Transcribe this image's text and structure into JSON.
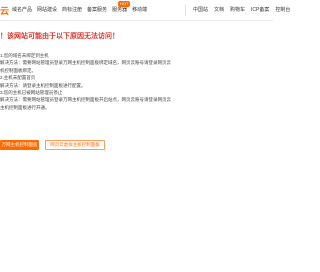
{
  "header": {
    "logo_text": "云",
    "nav_left": [
      "域名产品",
      "网站建设",
      "商标注册",
      "备案服务",
      "服务器",
      "移动端"
    ],
    "hot_badge": "HOT",
    "nav_right": [
      "中国站",
      "文档",
      "购物车",
      "ICP备案",
      "控制台"
    ]
  },
  "main": {
    "headline": "！该网站可能由于以下原因无法访问！",
    "reasons": [
      "1.您的域名未绑定到主机",
      "解决方法：需要网站管理员登录万网主机控制面板绑定域名，网页云账号请登录网页云",
      "机控制面板绑定。",
      "2.主机未配置首页",
      "解决方法：请登录主机控制面板进行配置。",
      "3.您的主机已被网站管理员停止",
      "解决方法：需要网站管理员登录万网主机控制面板开启站点，网页云账号请登录网页云",
      "主机控制面板进行开通。"
    ],
    "primary_button": "万网主机控制面板",
    "secondary_button": "网页云虚拟主机控制面板"
  }
}
